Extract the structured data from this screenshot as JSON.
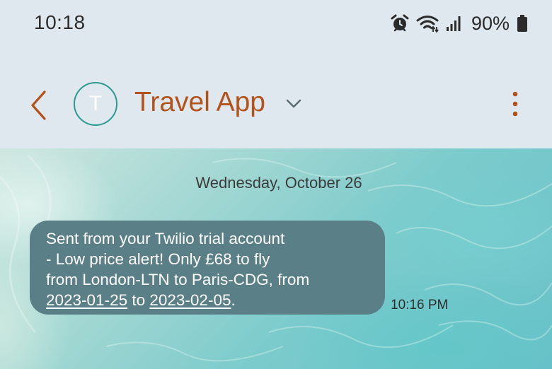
{
  "status_bar": {
    "time": "10:18",
    "battery": "90%",
    "icons": [
      "alarm-icon",
      "wifi-icon",
      "signal-icon",
      "battery-icon"
    ]
  },
  "header": {
    "contact_initial": "T",
    "contact_name": "Travel App",
    "icons": [
      "back-arrow-icon",
      "chevron-down-icon",
      "more-vertical-icon"
    ]
  },
  "conversation": {
    "date": "Wednesday, October 26",
    "messages": [
      {
        "lines": [
          "Sent from your Twilio trial account",
          "- Low price alert! Only £68 to fly",
          "from London-LTN to Paris-CDG, from"
        ],
        "date_from": "2023-01-25",
        "to_word": " to ",
        "date_to": "2023-02-05",
        "end": ".",
        "time": "10:16 PM"
      }
    ]
  },
  "colors": {
    "accent": "#b3521a",
    "avatar_ring": "#2a9a8e",
    "bubble": "#5a7f87",
    "header_bg": "#dfe8ee"
  }
}
